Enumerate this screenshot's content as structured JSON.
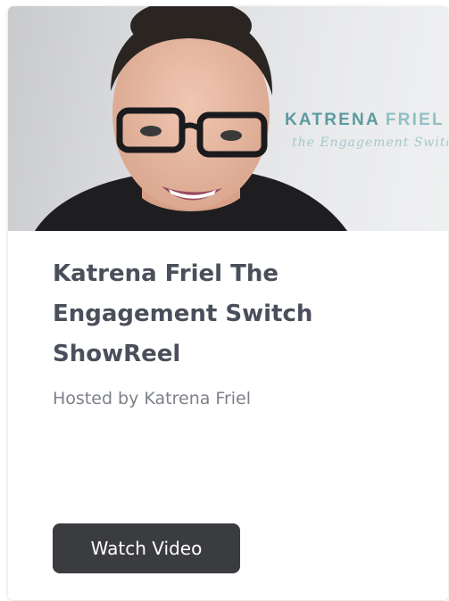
{
  "card": {
    "title": "Katrena Friel The Engagement Switch ShowReel",
    "host": "Hosted by Katrena Friel",
    "watch_label": "Watch Video"
  },
  "thumbnail": {
    "brand_first": "KATRENA",
    "brand_last": "FRIEL",
    "tagline": "the Engagement Switch"
  },
  "colors": {
    "brand_teal": "#5b9aa0",
    "brand_teal_light": "#8fc0c4",
    "title_text": "#4a4f5b",
    "host_text": "#7c8089",
    "button_bg": "#3b3c3f"
  }
}
